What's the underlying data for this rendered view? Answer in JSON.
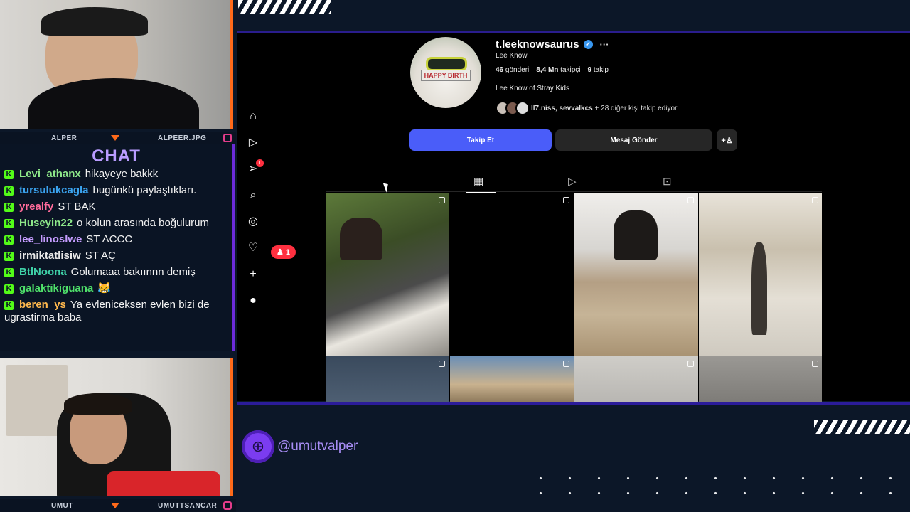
{
  "streamers": {
    "top_name": "ALPER",
    "top_handle": "ALPEER.JPG",
    "bottom_name": "UMUT",
    "bottom_handle": "UMUTTSANCAR"
  },
  "chat": {
    "title": "CHAT",
    "messages": [
      {
        "user": "Levi_athanx",
        "color": "#8ee88a",
        "text": "hikayeye bakkk"
      },
      {
        "user": "tursulukcagla",
        "color": "#3ba4f0",
        "text": "bugünkü paylaştıkları."
      },
      {
        "user": "yrealfy",
        "color": "#ff6b9a",
        "text": "ST BAK"
      },
      {
        "user": "Huseyin22",
        "color": "#8ee88a",
        "text": "o kolun arasında boğulurum"
      },
      {
        "user": "lee_linoslwe",
        "color": "#c59cff",
        "text": "ST ACCC"
      },
      {
        "user": "irmiktatlisiw",
        "color": "#e8e8e8",
        "text": "ST AÇ"
      },
      {
        "user": "BtlNoona",
        "color": "#3fd1a8",
        "text": "Golumaaa bakıınnn demiş"
      },
      {
        "user": "galaktikiguana",
        "color": "#4fe06a",
        "text": "😹"
      },
      {
        "user": "beren_ys",
        "color": "#ffb84d",
        "text": "Ya evleniceksen evlen bizi de ugrastirma baba"
      }
    ]
  },
  "profile": {
    "username": "t.leeknowsaurus",
    "full_name": "Lee Know",
    "posts_count": "46",
    "posts_label": "gönderi",
    "followers_count": "8,4 Mn",
    "followers_label": "takipçi",
    "following_count": "9",
    "following_label": "takip",
    "bio": "Lee Know of Stray Kids",
    "followed_by_users": "ll7.niss, sevvalkcs",
    "followed_by_rest": " + 28 diğer kişi takip ediyor",
    "avatar_text": "HAPPY BIRTH",
    "follow_button": "Takip Et",
    "message_button": "Mesaj Gönder"
  },
  "nav": {
    "notification_count": "1",
    "badge_count": "1"
  },
  "icons": [
    "home-icon",
    "reels-icon",
    "messages-icon",
    "search-icon",
    "explore-icon",
    "heart-icon",
    "create-icon",
    "profile-icon",
    "verified-icon",
    "add-user-icon",
    "grid-icon",
    "reels-tab-icon",
    "tagged-icon",
    "globe-icon"
  ],
  "branding": {
    "handle": "@umutvalper"
  },
  "colors": {
    "accent_purple": "#7b3cf0",
    "follow_blue": "#4a5df9",
    "notif_red": "#ff3040",
    "frame_orange": "#ff6a1a"
  }
}
